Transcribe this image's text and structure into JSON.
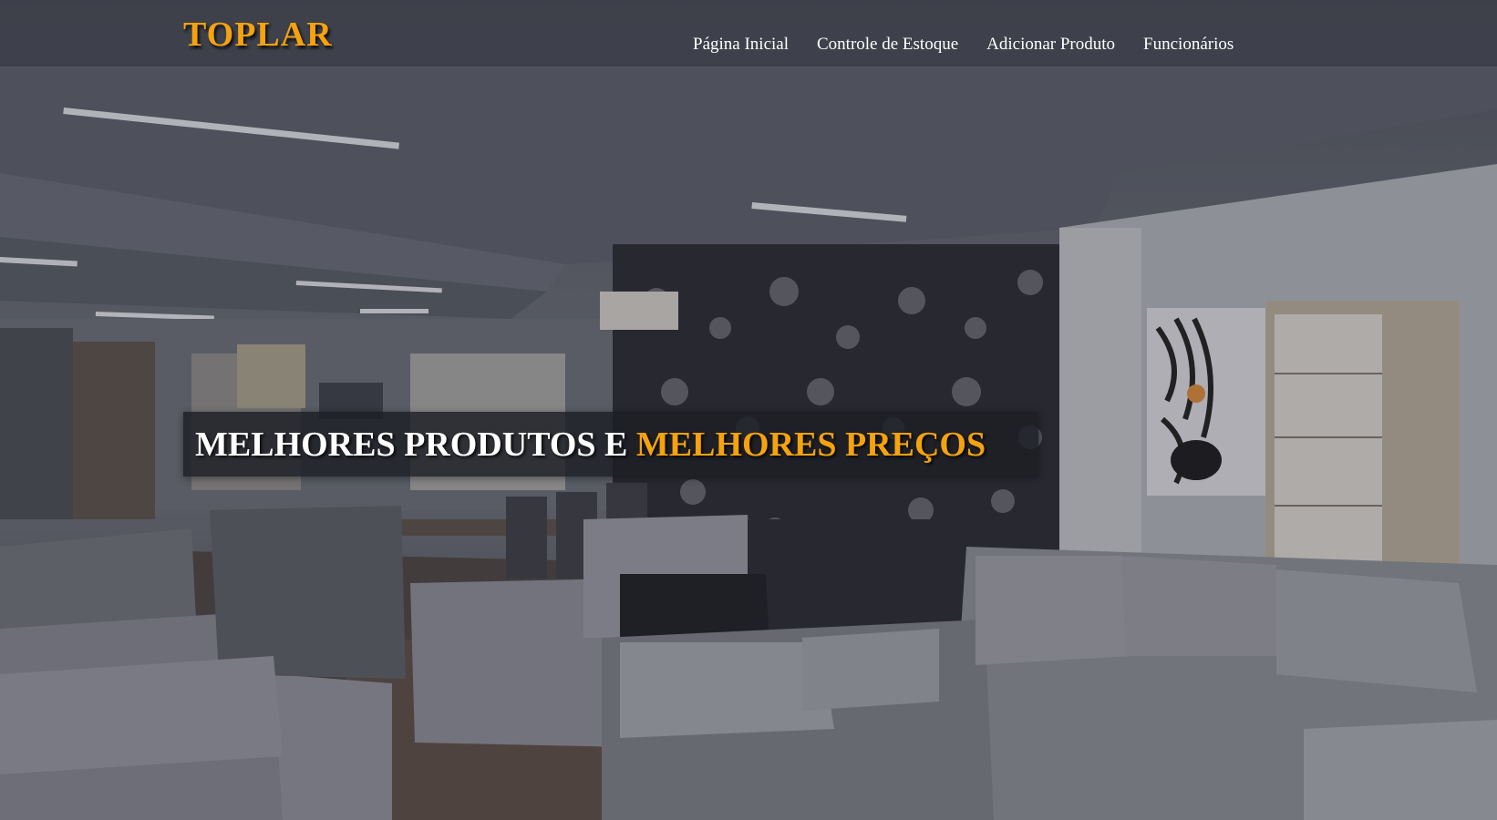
{
  "navbar": {
    "brand": "TOPLAR",
    "links": [
      {
        "label": "Página Inicial"
      },
      {
        "label": "Controle de Estoque"
      },
      {
        "label": "Adicionar Produto"
      },
      {
        "label": "Funcionários"
      }
    ]
  },
  "hero": {
    "headline_main": "MELHORES PRODUTOS E ",
    "headline_accent": "MELHORES PREÇOS"
  },
  "colors": {
    "accent": "#f5a20f",
    "navbar_bg": "#3c3f48",
    "text": "#ffffff"
  }
}
